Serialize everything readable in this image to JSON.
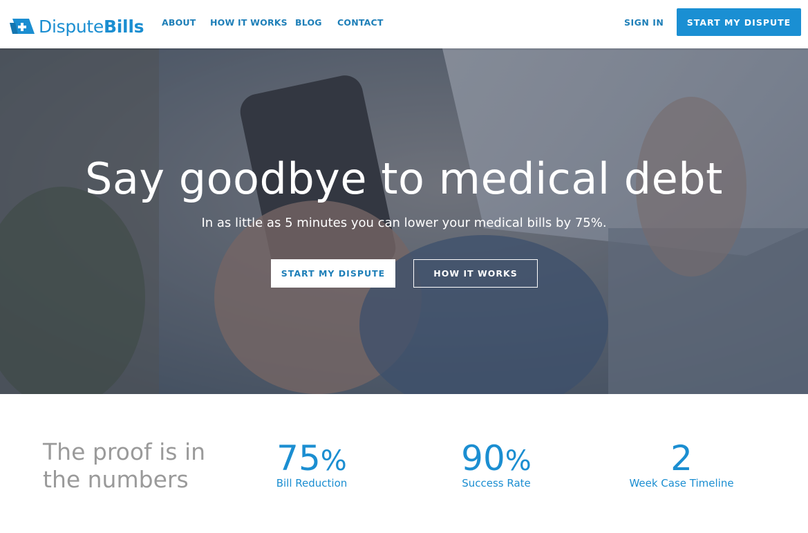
{
  "nav": {
    "logo": {
      "part1": "Dispute",
      "part2": "Bills",
      "icon": "medical-cross-flag-icon"
    },
    "links": [
      "ABOUT",
      "HOW IT WORKS",
      "BLOG",
      "CONTACT"
    ],
    "sign_in": "SIGN IN",
    "cta": "START MY DISPUTE"
  },
  "hero": {
    "title": "Say goodbye to medical debt",
    "subtitle": "In as little as 5 minutes you can lower your medical bills by 75%.",
    "primary_button": "START MY DISPUTE",
    "secondary_button": "HOW IT WORKS"
  },
  "stats": {
    "heading": "The proof is in the numbers",
    "items": [
      {
        "value": "75",
        "suffix": "%",
        "label": "Bill Reduction"
      },
      {
        "value": "90",
        "suffix": "%",
        "label": "Success Rate"
      },
      {
        "value": "2",
        "suffix": "",
        "label": "Week Case Timeline"
      }
    ]
  },
  "colors": {
    "brand": "#1b8ed1",
    "nav_link": "#1e7fb8",
    "muted": "#9a9a9a"
  }
}
